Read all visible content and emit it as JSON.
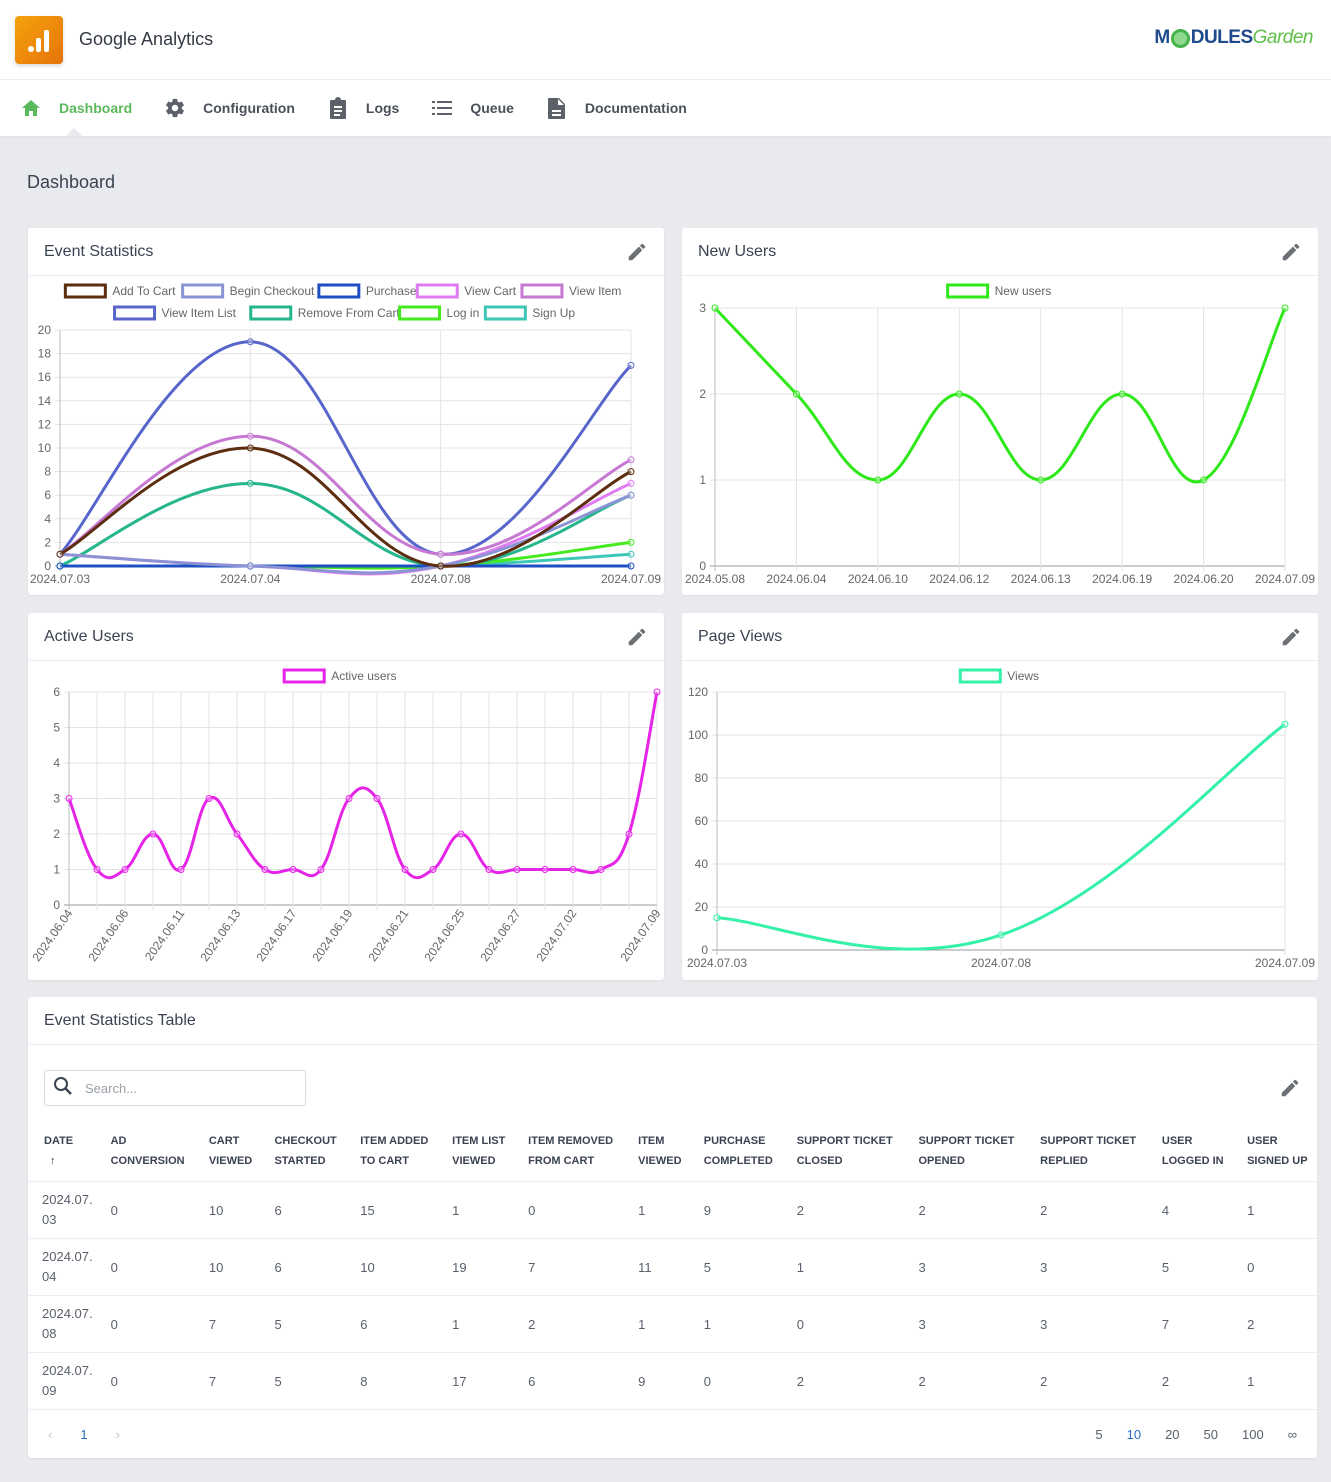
{
  "app": {
    "title": "Google Analytics",
    "brand_left": "M",
    "brand_mid": "DULES",
    "brand_right": "Garden"
  },
  "nav": [
    {
      "label": "Dashboard",
      "icon": "home-icon",
      "active": true
    },
    {
      "label": "Configuration",
      "icon": "gear-icon",
      "active": false
    },
    {
      "label": "Logs",
      "icon": "clipboard-icon",
      "active": false
    },
    {
      "label": "Queue",
      "icon": "list-icon",
      "active": false
    },
    {
      "label": "Documentation",
      "icon": "document-icon",
      "active": false
    }
  ],
  "page_title": "Dashboard",
  "cards": {
    "event_statistics": {
      "title": "Event Statistics"
    },
    "new_users": {
      "title": "New Users"
    },
    "active_users": {
      "title": "Active Users"
    },
    "page_views": {
      "title": "Page Views"
    },
    "table": {
      "title": "Event Statistics Table"
    }
  },
  "chart_data": [
    {
      "id": "event_statistics",
      "type": "line",
      "title": "Event Statistics",
      "categories": [
        "2024.07.03",
        "2024.07.04",
        "2024.07.08",
        "2024.07.09"
      ],
      "ylim": [
        0,
        20
      ],
      "yticks": [
        0,
        2,
        4,
        6,
        8,
        10,
        12,
        14,
        16,
        18,
        20
      ],
      "grid": true,
      "legend": "top",
      "series": [
        {
          "name": "Add To Cart",
          "color": "#5c2d0f",
          "values": [
            1,
            10,
            0,
            8
          ]
        },
        {
          "name": "Begin Checkout",
          "color": "#8b93d4",
          "values": [
            1,
            0,
            0,
            6
          ]
        },
        {
          "name": "Purchase",
          "color": "#1e4fc2",
          "values": [
            0,
            0,
            0,
            0
          ]
        },
        {
          "name": "View Cart",
          "color": "#df7cf2",
          "values": [
            1,
            0,
            0,
            7
          ]
        },
        {
          "name": "View Item",
          "color": "#c678d2",
          "values": [
            1,
            11,
            1,
            9
          ]
        },
        {
          "name": "View Item List",
          "color": "#5866cc",
          "values": [
            1,
            19,
            1,
            17
          ]
        },
        {
          "name": "Remove From Cart",
          "color": "#25b68c",
          "values": [
            0,
            7,
            0,
            6
          ]
        },
        {
          "name": "Log in",
          "color": "#44ea1e",
          "values": [
            0,
            0,
            0,
            2
          ]
        },
        {
          "name": "Sign Up",
          "color": "#3ec7b6",
          "values": [
            0,
            0,
            0,
            1
          ]
        }
      ]
    },
    {
      "id": "new_users",
      "type": "line",
      "title": "New Users",
      "categories": [
        "2024.05.08",
        "2024.06.04",
        "2024.06.10",
        "2024.06.12",
        "2024.06.13",
        "2024.06.19",
        "2024.06.20",
        "2024.07.09"
      ],
      "ylim": [
        0,
        3
      ],
      "yticks": [
        0,
        1,
        2,
        3
      ],
      "grid": true,
      "legend": "top",
      "series": [
        {
          "name": "New users",
          "color": "#2ee81a",
          "values": [
            3,
            2,
            1,
            2,
            1,
            2,
            1,
            3
          ]
        }
      ]
    },
    {
      "id": "active_users",
      "type": "line",
      "title": "Active Users",
      "categories": [
        "2024.06.04",
        "",
        "2024.06.06",
        "",
        "2024.06.11",
        "",
        "2024.06.13",
        "",
        "2024.06.17",
        "",
        "2024.06.19",
        "",
        "2024.06.21",
        "",
        "2024.06.25",
        "",
        "2024.06.27",
        "",
        "2024.07.02",
        "",
        "",
        "2024.07.09"
      ],
      "ylim": [
        0,
        6
      ],
      "yticks": [
        0,
        1,
        2,
        3,
        4,
        5,
        6
      ],
      "grid": true,
      "legend": "top",
      "series": [
        {
          "name": "Active users",
          "color": "#e524e8",
          "values": [
            3,
            1,
            1,
            2,
            1,
            3,
            2,
            1,
            1,
            1,
            3,
            3,
            1,
            1,
            2,
            1,
            1,
            1,
            1,
            1,
            2,
            6
          ]
        }
      ]
    },
    {
      "id": "page_views",
      "type": "line",
      "title": "Page Views",
      "categories": [
        "2024.07.03",
        "2024.07.08",
        "2024.07.09"
      ],
      "ylim": [
        0,
        120
      ],
      "yticks": [
        0,
        20,
        40,
        60,
        80,
        100,
        120
      ],
      "grid": true,
      "legend": "top",
      "series": [
        {
          "name": "Views",
          "color": "#34f0a8",
          "values": [
            15,
            7,
            105
          ]
        }
      ]
    }
  ],
  "table": {
    "search_placeholder": "Search...",
    "sort_indicator": "↑",
    "columns": [
      [
        "DATE",
        ""
      ],
      [
        "AD",
        "CONVERSION"
      ],
      [
        "CART",
        "VIEWED"
      ],
      [
        "CHECKOUT",
        "STARTED"
      ],
      [
        "ITEM ADDED",
        "TO CART"
      ],
      [
        "ITEM LIST",
        "VIEWED"
      ],
      [
        "ITEM REMOVED",
        "FROM CART"
      ],
      [
        "ITEM",
        "VIEWED"
      ],
      [
        "PURCHASE",
        "COMPLETED"
      ],
      [
        "SUPPORT TICKET",
        "CLOSED"
      ],
      [
        "SUPPORT TICKET",
        "OPENED"
      ],
      [
        "SUPPORT TICKET",
        "REPLIED"
      ],
      [
        "USER",
        "LOGGED IN"
      ],
      [
        "USER",
        "SIGNED UP"
      ]
    ],
    "rows": [
      [
        "2024.07. 03",
        "0",
        "10",
        "6",
        "15",
        "1",
        "0",
        "1",
        "9",
        "2",
        "2",
        "2",
        "4",
        "1"
      ],
      [
        "2024.07. 04",
        "0",
        "10",
        "6",
        "10",
        "19",
        "7",
        "11",
        "5",
        "1",
        "3",
        "3",
        "5",
        "0"
      ],
      [
        "2024.07. 08",
        "0",
        "7",
        "5",
        "6",
        "1",
        "2",
        "1",
        "1",
        "0",
        "3",
        "3",
        "7",
        "2"
      ],
      [
        "2024.07. 09",
        "0",
        "7",
        "5",
        "8",
        "17",
        "6",
        "9",
        "0",
        "2",
        "2",
        "2",
        "2",
        "1"
      ]
    ],
    "pagination": {
      "prev": "‹",
      "current_page": "1",
      "next": "›",
      "page_sizes": [
        "5",
        "10",
        "20",
        "50",
        "100",
        "∞"
      ],
      "selected_size": "10"
    }
  }
}
